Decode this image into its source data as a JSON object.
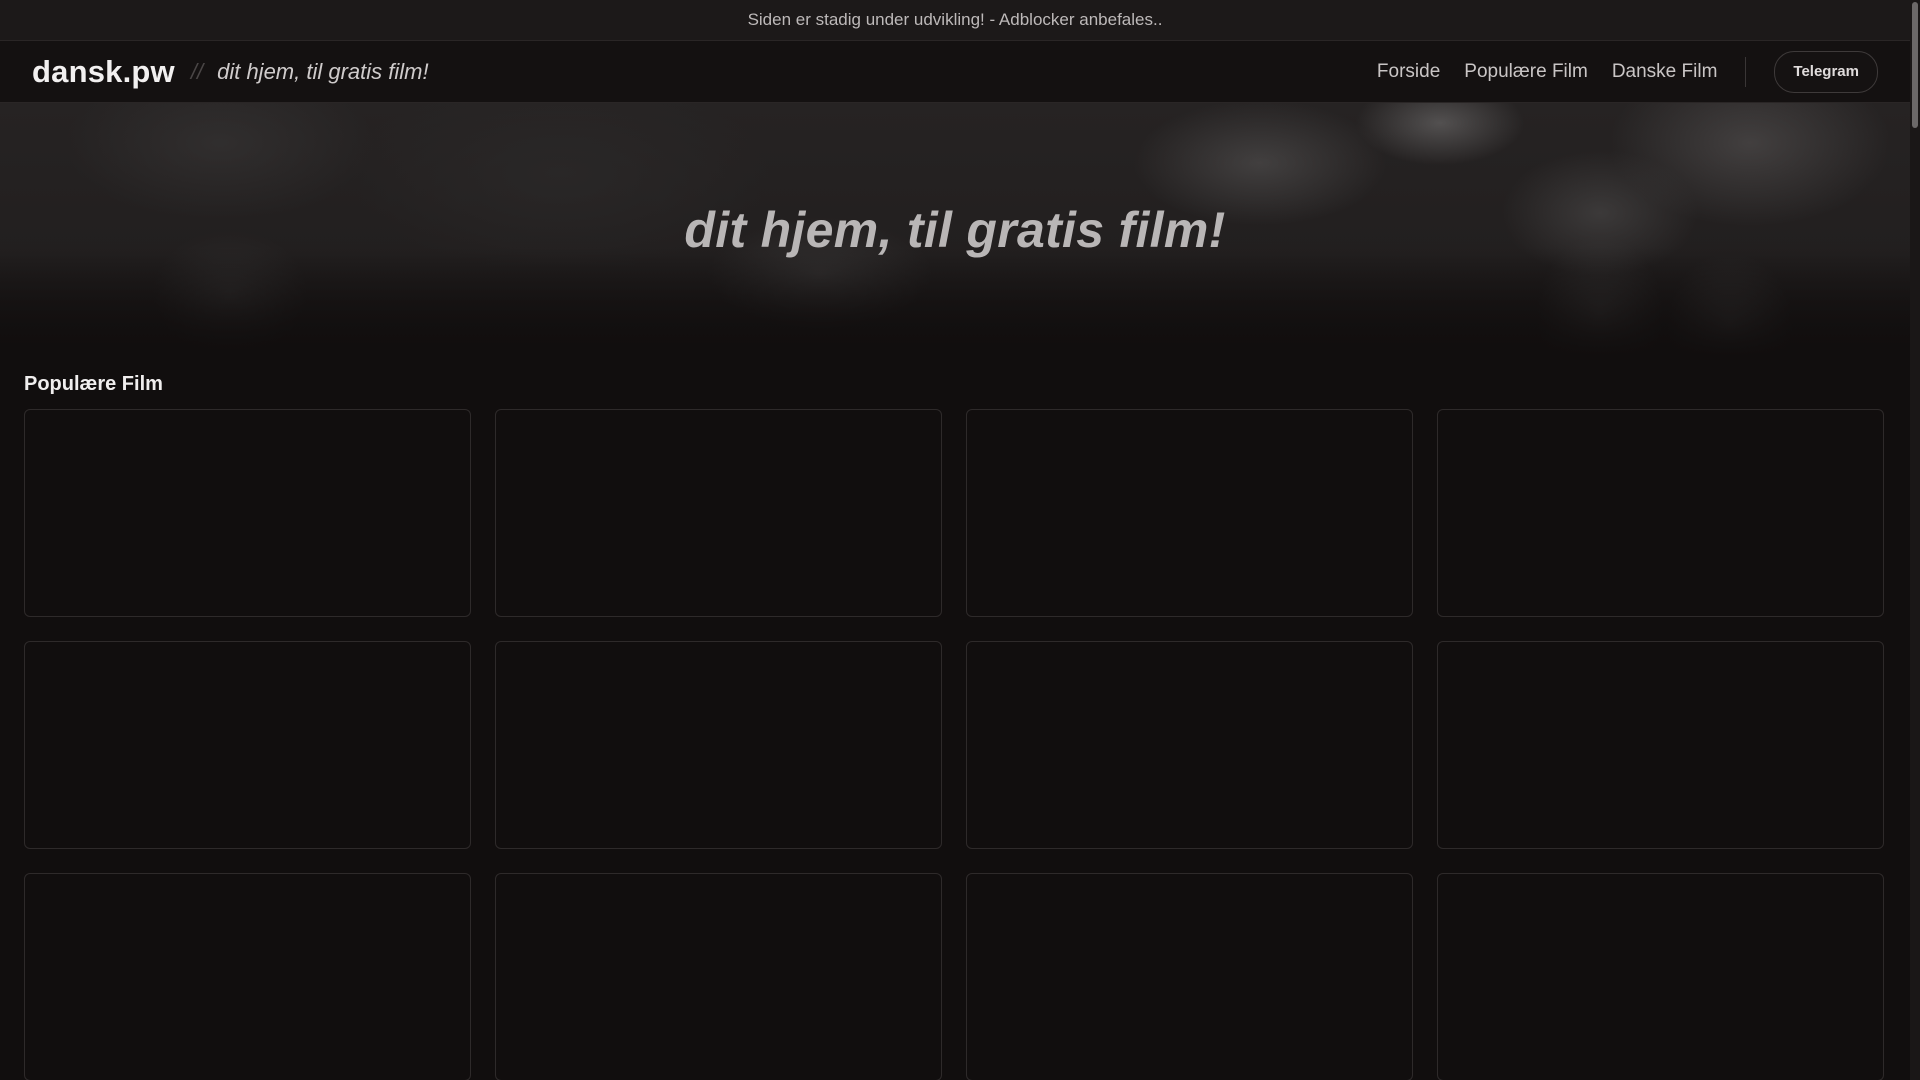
{
  "announcement": {
    "text": "Siden er stadig under udvikling! - Adblocker anbefales.."
  },
  "navbar": {
    "brand": "dansk.pw",
    "separator": "//",
    "tagline": "dit hjem, til gratis film!",
    "links": [
      {
        "label": "Forside"
      },
      {
        "label": "Populære Film"
      },
      {
        "label": "Danske Film"
      }
    ],
    "telegram_label": "Telegram"
  },
  "hero": {
    "title": "dit hjem, til gratis film!"
  },
  "popular": {
    "title": "Populære Film",
    "cards_visible": 12
  },
  "colors": {
    "background": "#110e0e",
    "card_border": "#2e2a2a",
    "text": "#e8e6e6"
  }
}
